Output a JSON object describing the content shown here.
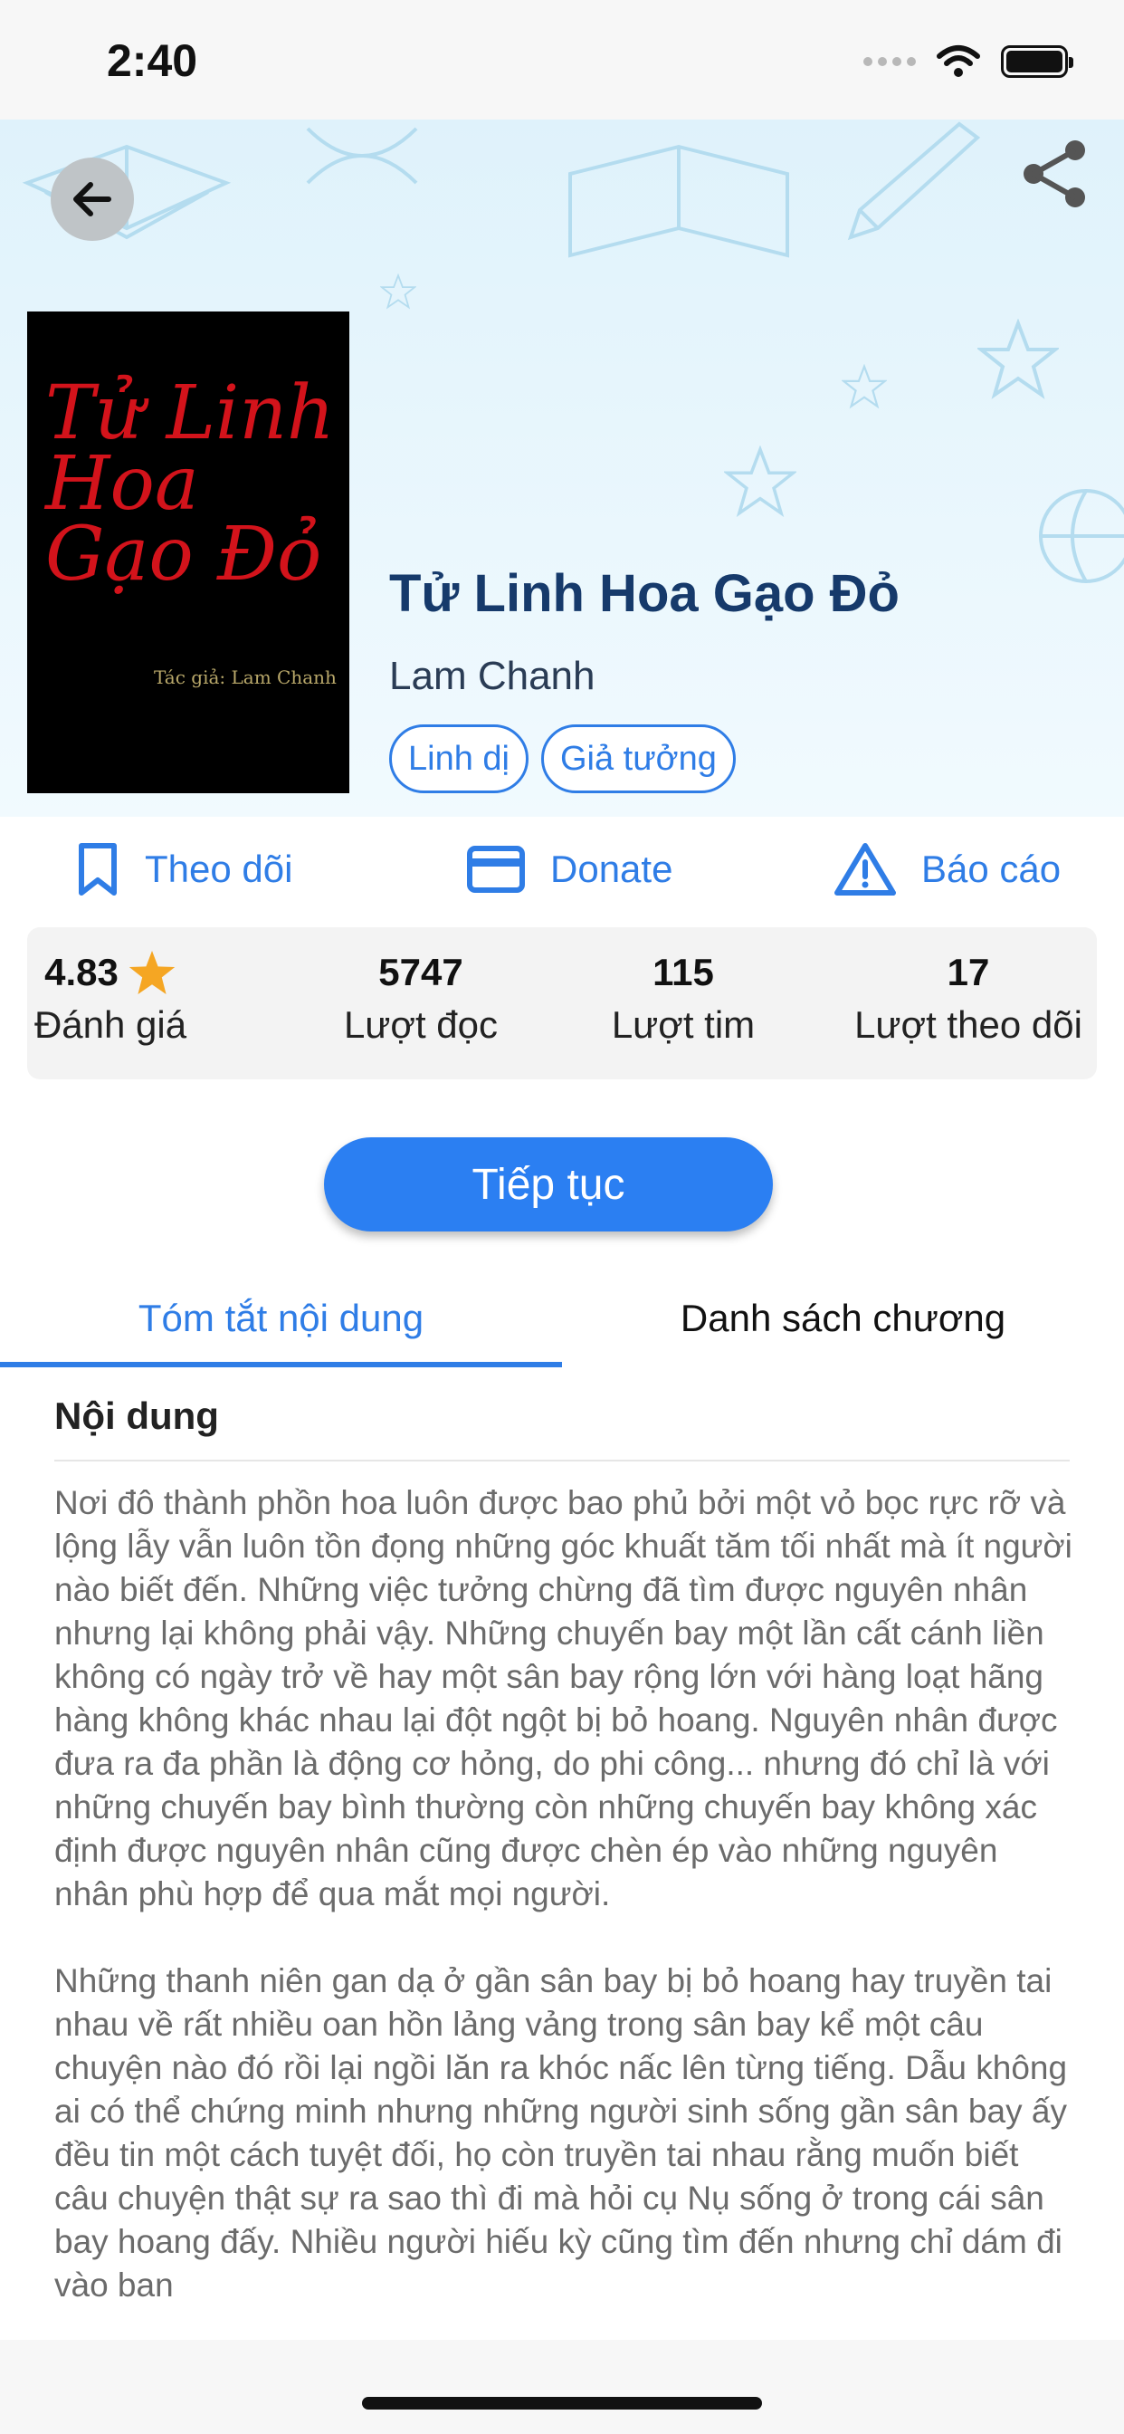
{
  "status_bar": {
    "time": "2:40"
  },
  "book": {
    "title": "Tử Linh Hoa Gạo Đỏ",
    "author": "Lam Chanh",
    "cover_title": "Tử Linh Hoa Gạo Đỏ",
    "cover_author": "Tác giả: Lam Chanh",
    "tags": [
      "Linh dị",
      "Giả tưởng"
    ]
  },
  "actions": {
    "follow": "Theo dõi",
    "donate": "Donate",
    "report": "Báo cáo"
  },
  "stats": {
    "rating": {
      "value": "4.83",
      "label": "Đánh giá"
    },
    "reads": {
      "value": "5747",
      "label": "Lượt đọc"
    },
    "hearts": {
      "value": "115",
      "label": "Lượt tim"
    },
    "followers": {
      "value": "17",
      "label": "Lượt theo dõi"
    }
  },
  "continue_label": "Tiếp tục",
  "tabs": [
    {
      "label": "Tóm tắt nội dung",
      "active": true
    },
    {
      "label": "Danh sách chương",
      "active": false
    }
  ],
  "content": {
    "section_title": "Nội dung",
    "paragraphs": [
      "Nơi đô thành phồn hoa luôn được bao phủ bởi một vỏ bọc rực rỡ và lộng lẫy vẫn luôn tồn đọng những góc khuất tăm tối nhất mà ít người nào biết đến. Những việc tưởng chừng đã tìm được nguyên nhân nhưng lại không phải vậy. Những chuyến bay một lần cất cánh liền không có ngày trở về hay một sân bay rộng lớn với hàng loạt hãng hàng không khác nhau lại đột ngột bị bỏ hoang. Nguyên nhân được đưa ra đa phần là động cơ hỏng, do phi công... nhưng đó chỉ là với những chuyến bay bình thường còn những chuyến bay không xác định được nguyên nhân cũng được chèn ép vào những nguyên nhân phù hợp để qua mắt mọi người.",
      "Những thanh niên gan dạ ở gần sân bay bị bỏ hoang hay truyền tai nhau về rất nhiều oan hồn lảng vảng trong sân bay kể một câu chuyện nào đó rồi lại ngồi lăn ra khóc nấc lên từng tiếng. Dẫu không ai có thể chứng minh nhưng những người sinh sống gần sân bay ấy đều tin một cách tuyệt đối, họ còn truyền tai nhau rằng muốn biết câu chuyện thật sự ra sao thì đi mà hỏi cụ Nụ sống ở trong cái sân bay hoang đấy. Nhiều người hiếu kỳ cũng tìm đến nhưng chỉ dám đi vào ban"
    ]
  },
  "colors": {
    "accent": "#2f7de6",
    "title": "#163a6b",
    "star": "#f5a623",
    "button": "#2b7ff2"
  },
  "icons": {
    "back": "arrow-left-icon",
    "share": "share-icon",
    "follow": "bookmark-icon",
    "donate": "credit-card-icon",
    "report": "warning-triangle-icon",
    "rating": "star-icon"
  }
}
